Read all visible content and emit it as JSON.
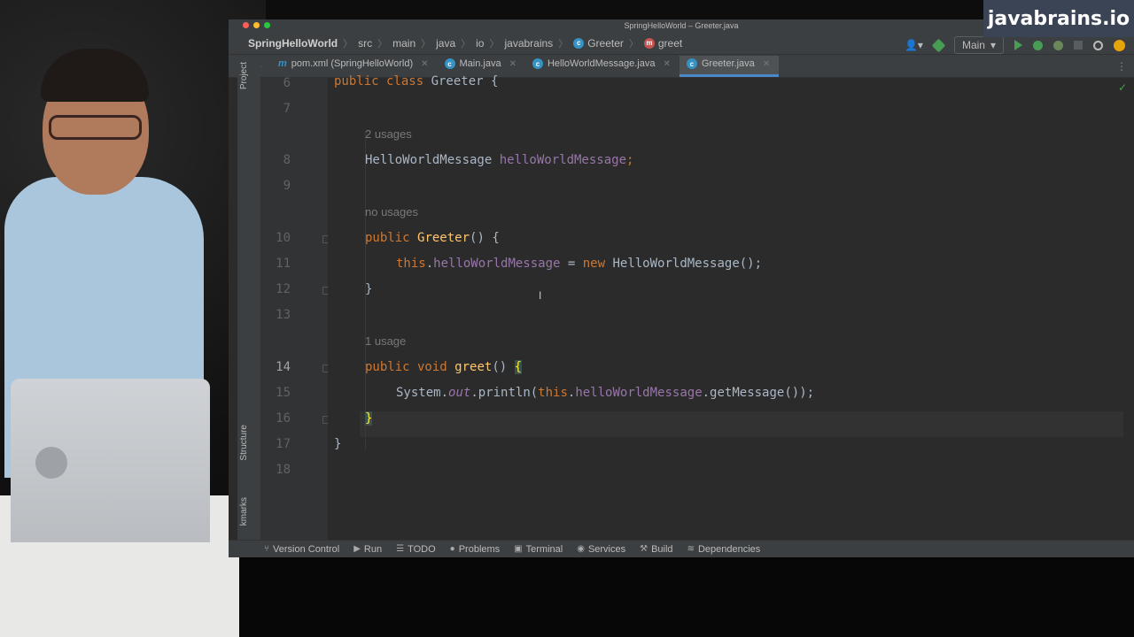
{
  "window": {
    "title": "SpringHelloWorld – Greeter.java"
  },
  "brand": "javabrains.io",
  "breadcrumb": [
    "SpringHelloWorld",
    "src",
    "main",
    "java",
    "io",
    "javabrains",
    "Greeter",
    "greet"
  ],
  "toolbar": {
    "run_config": "Main"
  },
  "tabs": [
    {
      "label": "pom.xml (SpringHelloWorld)",
      "icon": "maven-icon"
    },
    {
      "label": "Main.java",
      "icon": "class-icon"
    },
    {
      "label": "HelloWorldMessage.java",
      "icon": "class-icon"
    },
    {
      "label": "Greeter.java",
      "icon": "class-icon",
      "active": true
    }
  ],
  "side_tools": {
    "project": "Project",
    "structure": "Structure",
    "bookmarks": "kmarks"
  },
  "editor": {
    "lines": [
      "6",
      "7",
      "8",
      "9",
      "10",
      "11",
      "12",
      "13",
      "14",
      "15",
      "16",
      "17",
      "18"
    ],
    "hints": {
      "h1": "2 usages",
      "h2": "no usages",
      "h3": "1 usage"
    },
    "code": {
      "l6a": "public class ",
      "l6b": "Greeter {",
      "l8a": "HelloWorldMessage ",
      "l8b": "helloWorldMessage",
      "l8c": ";",
      "l10a": "public ",
      "l10b": "Greeter",
      "l10c": "() {",
      "l11a": "this",
      "l11b": ".",
      "l11c": "helloWorldMessage",
      "l11d": " = ",
      "l11e": "new ",
      "l11f": "HelloWorldMessage();",
      "l12": "}",
      "l14a": "public void ",
      "l14b": "greet",
      "l14c": "() ",
      "l14d": "{",
      "l15a": "System.",
      "l15b": "out",
      "l15c": ".println(",
      "l15d": "this",
      "l15e": ".",
      "l15f": "helloWorldMessage",
      "l15g": ".getMessage());",
      "l16": "}",
      "l17": "}"
    }
  },
  "bottombar": [
    {
      "label": "Version Control",
      "icon": "branch-icon"
    },
    {
      "label": "Run",
      "icon": "run-icon"
    },
    {
      "label": "TODO",
      "icon": "list-icon"
    },
    {
      "label": "Problems",
      "icon": "info-icon"
    },
    {
      "label": "Terminal",
      "icon": "terminal-icon"
    },
    {
      "label": "Services",
      "icon": "services-icon"
    },
    {
      "label": "Build",
      "icon": "hammer-icon"
    },
    {
      "label": "Dependencies",
      "icon": "layers-icon"
    }
  ],
  "colors": {
    "editor_bg": "#2b2b2b",
    "keyword": "#cc7832",
    "field": "#9876aa",
    "method": "#ffc66d",
    "accent": "#4a88c7"
  }
}
